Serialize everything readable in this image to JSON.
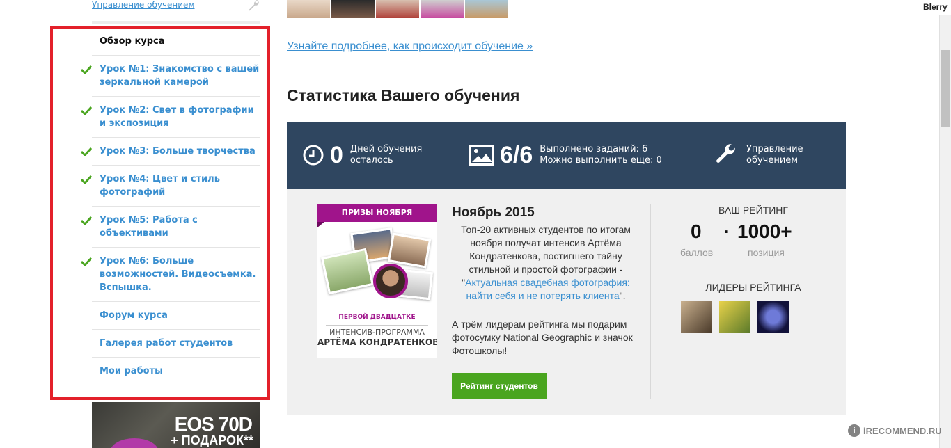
{
  "sidebar": {
    "top_link": "Управление обучением",
    "menu": [
      {
        "label": "Обзор курса",
        "current": true,
        "checked": false
      },
      {
        "label": "Урок №1: Знакомство с вашей зеркальной камерой",
        "checked": true
      },
      {
        "label": "Урок №2: Свет в фотографии и экспозиция",
        "checked": true
      },
      {
        "label": "Урок №3: Больше творчества",
        "checked": true
      },
      {
        "label": "Урок №4: Цвет и стиль фотографий",
        "checked": true
      },
      {
        "label": "Урок №5: Работа с объективами",
        "checked": true
      },
      {
        "label": "Урок №6: Больше возможностей. Видеосъемка. Вспышка.",
        "checked": true
      },
      {
        "label": "Форум курса",
        "checked": false
      },
      {
        "label": "Галерея работ студентов",
        "checked": false
      },
      {
        "label": "Мои работы",
        "checked": false
      }
    ],
    "banner": {
      "title": "EOS 70D",
      "subtitle": "+ ПОДАРОК**"
    }
  },
  "main": {
    "learn_more": "Узнайте подробнее, как происходит обучение »",
    "section_title": "Статистика Вашего обучения",
    "stats": {
      "days": {
        "value": "0",
        "line1": "Дней обучения",
        "line2": "осталось",
        "icon": "clock-icon"
      },
      "tasks": {
        "value": "6/6",
        "line1": "Выполнено заданий: 6",
        "line2": "Можно выполнить еще: 0",
        "icon": "image-icon"
      },
      "manage": {
        "line1": "Управление",
        "line2": "обучением",
        "icon": "wrench-icon"
      }
    },
    "promo": {
      "ribbon": "ПРИЗЫ НОЯБРЯ",
      "first": "ПЕРВОЙ ДВАДЦАТКЕ",
      "intensive": "ИНТЕНСИВ-ПРОГРАММА",
      "name": "АРТЁМА КОНДРАТЕНКОВА",
      "title": "Ноябрь 2015",
      "desc_before": "Топ-20 активных студентов по итогам ноября получат интенсив Артёма Кондратенкова, постигшего тайну стильной и простой фотографии - \"",
      "desc_link": "Актуальная свадебная фотография: найти себя и не потерять клиента",
      "desc_after": "\".",
      "gift": "А трём лидерам рейтинга мы подарим фотосумку National Geographic и значок Фотошколы!",
      "button": "Рейтинг студентов"
    },
    "rating": {
      "title": "ВАШ РЕЙТИНГ",
      "points": "0",
      "points_label": "баллов",
      "sep": "·",
      "position": "1000+",
      "position_label": "позиция",
      "leaders_title": "ЛИДЕРЫ РЕЙТИНГА"
    }
  },
  "browser": {
    "user": "Blerry"
  },
  "watermark": "iRECOMMEND.RU",
  "colors": {
    "accent": "#3a8fd0",
    "stats_bg": "#2f4660",
    "green": "#4aa51f",
    "highlight": "#e3202a",
    "purple": "#a0148b"
  }
}
